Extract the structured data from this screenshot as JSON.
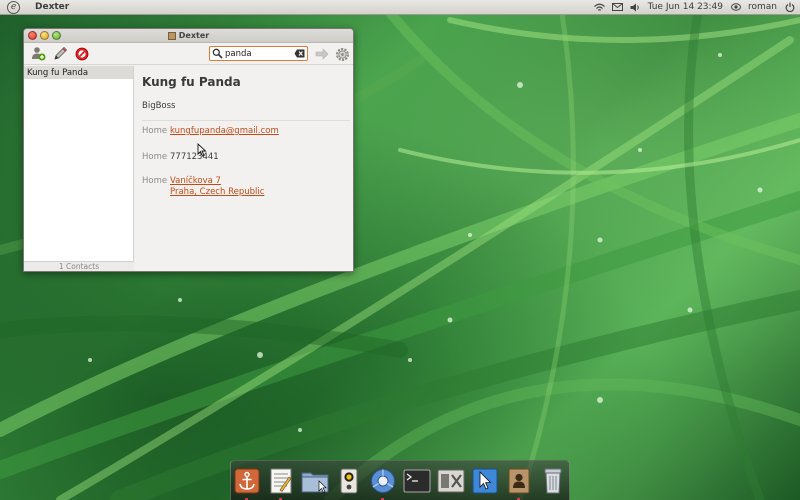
{
  "top_panel": {
    "app_name": "Dexter",
    "datetime": "Tue Jun 14 23:49",
    "user": "roman"
  },
  "window": {
    "title": "Dexter",
    "search": {
      "value": "panda"
    },
    "contacts": [
      {
        "name": "Kung fu Panda"
      }
    ],
    "contact_count": "1 Contacts",
    "detail": {
      "name": "Kung fu Panda",
      "organization": "BigBoss",
      "email_label": "Home",
      "email": "kungfupanda@gmail.com",
      "phone_label": "Home",
      "phone": "777123441",
      "address_label": "Home",
      "address_line1": "Vaníčkova 7",
      "address_line2": "Praha, Czech Republic"
    }
  },
  "dock": {
    "items": [
      "anchor-icon",
      "text-editor-icon",
      "folder-icon",
      "speaker-icon",
      "chromium-icon",
      "terminal-icon",
      "system-tools-icon",
      "cursor-app-icon",
      "contacts-icon",
      "trash-icon"
    ]
  },
  "colors": {
    "accent": "#c84b17",
    "search_focus": "#e07a3a",
    "selection": "#dcdbd8"
  }
}
